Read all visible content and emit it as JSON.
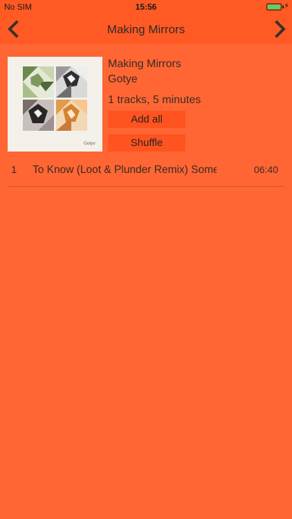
{
  "status": {
    "carrier": "No SIM",
    "time": "15:56",
    "battery_level": 1.0
  },
  "nav": {
    "title": "Making Mirrors",
    "back_icon": "chevron-left-icon",
    "forward_icon": "chevron-right-icon"
  },
  "album": {
    "name": "Making Mirrors",
    "artist": "Gotye",
    "summary": "1 tracks, 5 minutes",
    "art_signature": "Gotye"
  },
  "actions": {
    "add_all": "Add all",
    "shuffle": "Shuffle"
  },
  "tracks": [
    {
      "number": "1",
      "title": "To Know (Loot & Plunder Remix)  Somebody That I Used To Know",
      "duration": "06:40"
    }
  ],
  "colors": {
    "background": "#FF6633",
    "bar": "#FF5A24",
    "button": "#FF5420",
    "battery": "#4CD964"
  }
}
